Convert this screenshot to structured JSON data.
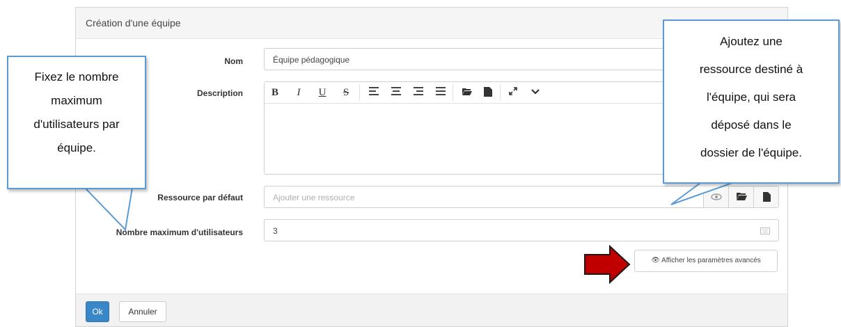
{
  "modal": {
    "title": "Création d'une équipe",
    "name_label": "Nom",
    "name_value": "Équipe pédagogique",
    "description_label": "Description",
    "resource_label": "Ressource par défaut",
    "resource_placeholder": "Ajouter une ressource",
    "max_users_label": "Nombre maximum d'utilisateurs",
    "max_users_value": "3",
    "advanced_label": "Afficher les paramètres avancés",
    "toolbar": {
      "bold": "B",
      "italic": "I",
      "underline": "U",
      "strike": "S"
    }
  },
  "footer": {
    "ok_label": "Ok",
    "cancel_label": "Annuler"
  },
  "callouts": {
    "left": [
      "Fixez le nombre",
      "maximum",
      "d'utilisateurs par",
      "équipe."
    ],
    "right": [
      "Ajoutez une",
      "ressource destiné à",
      "l'équipe, qui sera",
      "déposé dans le",
      "dossier de l'équipe."
    ]
  },
  "colors": {
    "primary": "#3a87c8",
    "callout_border": "#5b9bd5",
    "arrow": "#c00000"
  }
}
